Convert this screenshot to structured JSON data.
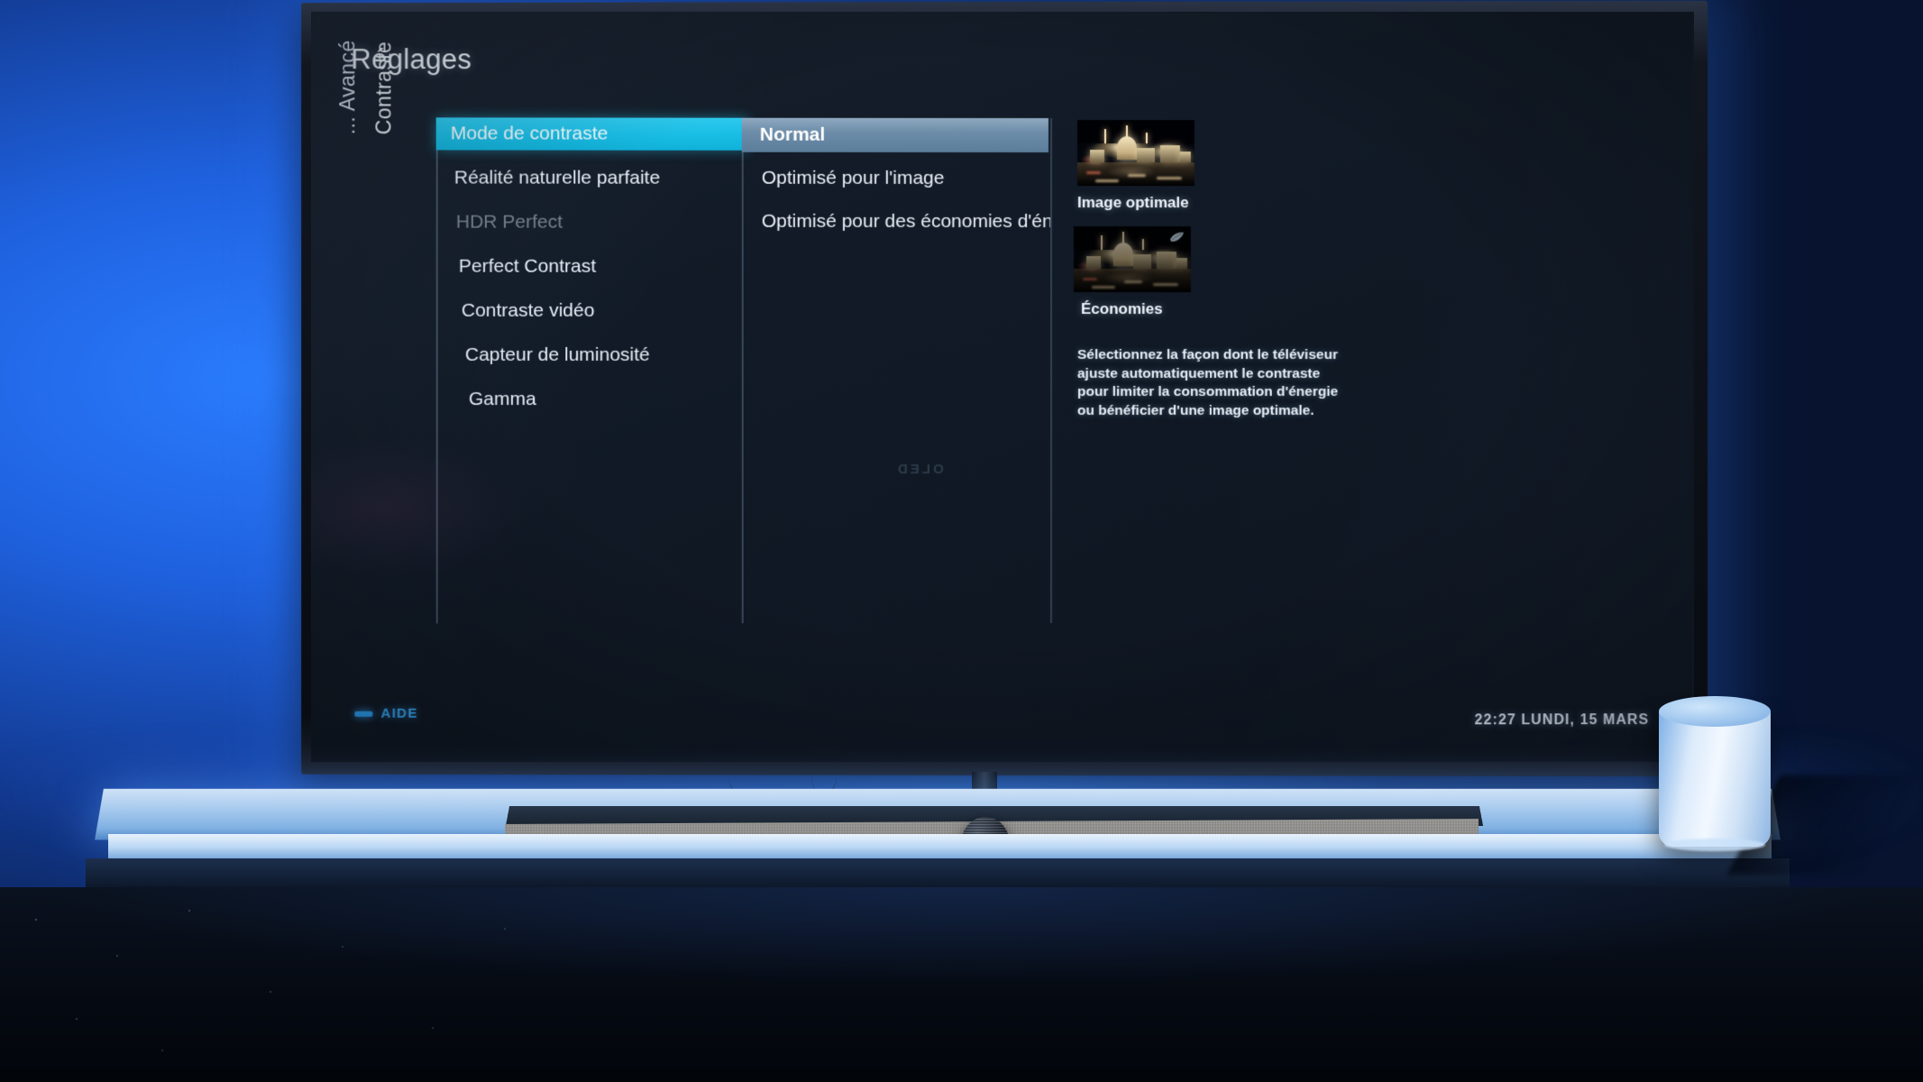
{
  "screen": {
    "title": "Réglages",
    "breadcrumb": {
      "parent": "... Avancé",
      "current": "Contraste"
    },
    "menu_column": {
      "items": [
        {
          "label": "Mode de contraste",
          "state": "selected"
        },
        {
          "label": "Réalité naturelle parfaite",
          "state": "normal"
        },
        {
          "label": "HDR Perfect",
          "state": "disabled"
        },
        {
          "label": "Perfect Contrast",
          "state": "normal"
        },
        {
          "label": "Contraste vidéo",
          "state": "normal"
        },
        {
          "label": "Capteur de luminosité",
          "state": "normal"
        },
        {
          "label": "Gamma",
          "state": "normal"
        }
      ]
    },
    "options_column": {
      "items": [
        {
          "label": "Normal",
          "state": "selected"
        },
        {
          "label": "Optimisé pour l'image",
          "state": "normal"
        },
        {
          "label": "Optimisé pour des économies d'éner",
          "state": "normal"
        }
      ]
    },
    "preview_column": {
      "thumbnails": [
        {
          "label": "Image optimale",
          "icon": "none"
        },
        {
          "label": "Économies",
          "icon": "leaf-icon"
        }
      ],
      "description": "Sélectionnez la façon dont le téléviseur ajuste automatiquement le contraste pour limiter la consommation d'énergie ou bénéficier d'une image optimale."
    },
    "footer": {
      "help_label": "AIDE",
      "help_icon": "blue-dash-icon",
      "clock": "22:27 LUNDI, 15 MARS"
    },
    "reflection_artifact": "OLED"
  },
  "colors": {
    "accent_cyan": "#18bde4",
    "selected_option": "#6d8da9",
    "panel_background": "#121a26",
    "help_blue": "#3aa8f5",
    "ambient_blue": "#1f62e0"
  }
}
